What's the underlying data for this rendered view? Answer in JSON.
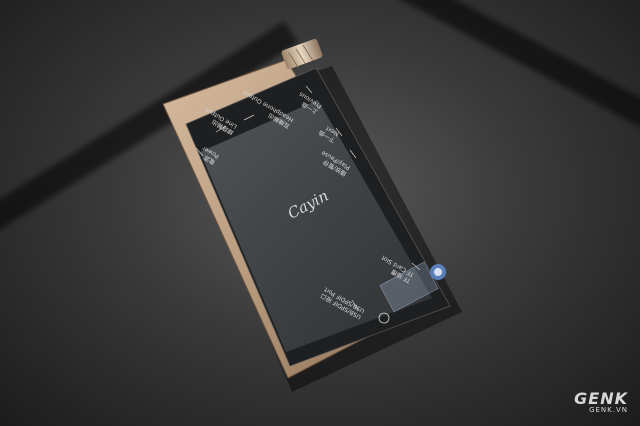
{
  "device_labels": {
    "line_output_cn": "線路輸出",
    "line_output_en": "Line Output",
    "headphone_output_cn": "耳機輸出",
    "headphone_output_en": "Headphone Output",
    "previous_cn": "上一曲",
    "previous_en": "Previous",
    "power_cn": "電源",
    "power_en": "Power",
    "next_cn": "下一曲",
    "next_en": "Next",
    "play_pause_cn": "播放/暫停",
    "play_pause_en": "Play/Pause",
    "tf_card_cn": "TF 插槽",
    "tf_card_en": "TF Card Slot",
    "usb_cn": "USB/SPDIF 接口",
    "usb_en": "USB/SPDIF Port",
    "signature": "Cayin"
  },
  "watermark": {
    "mark": "GENK",
    "url": "GENK.VN"
  },
  "colors": {
    "body_gold": "#b89a7c",
    "screen": "#3c3f41",
    "background": "#3a3a3a"
  }
}
